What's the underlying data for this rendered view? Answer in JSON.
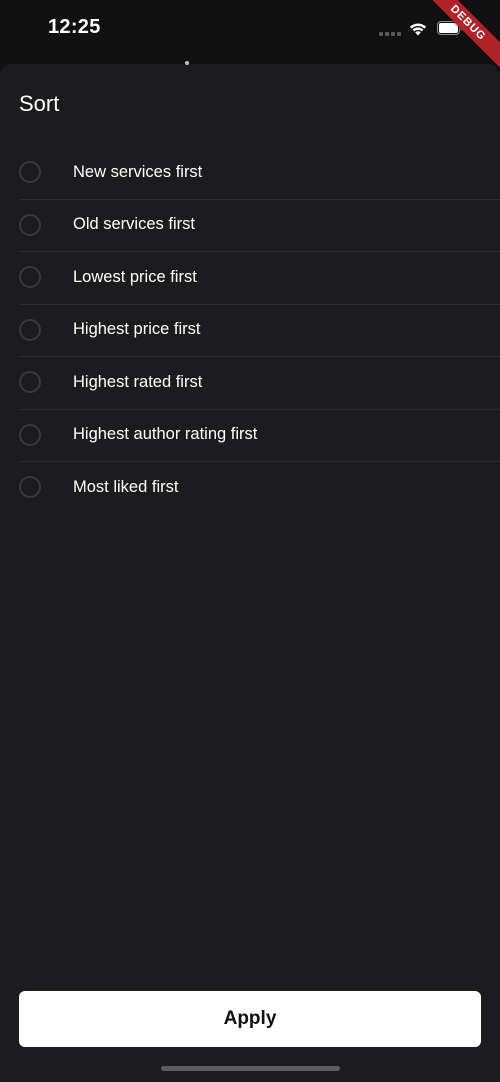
{
  "status_bar": {
    "time": "12:25",
    "debug_label": "DEBUG",
    "icons": [
      "signal-icon",
      "wifi-icon",
      "battery-icon"
    ]
  },
  "sheet": {
    "title": "Sort",
    "options": [
      {
        "label": "New services first",
        "selected": false
      },
      {
        "label": "Old services first",
        "selected": false
      },
      {
        "label": "Lowest price first",
        "selected": false
      },
      {
        "label": "Highest price first",
        "selected": false
      },
      {
        "label": "Highest rated first",
        "selected": false
      },
      {
        "label": "Highest author rating first",
        "selected": false
      },
      {
        "label": "Most liked first",
        "selected": false
      }
    ],
    "apply_label": "Apply"
  },
  "colors": {
    "background": "#1c1c1e",
    "status_bar": "#111112",
    "debug_banner": "#b0232a",
    "button": "#ffffff"
  }
}
